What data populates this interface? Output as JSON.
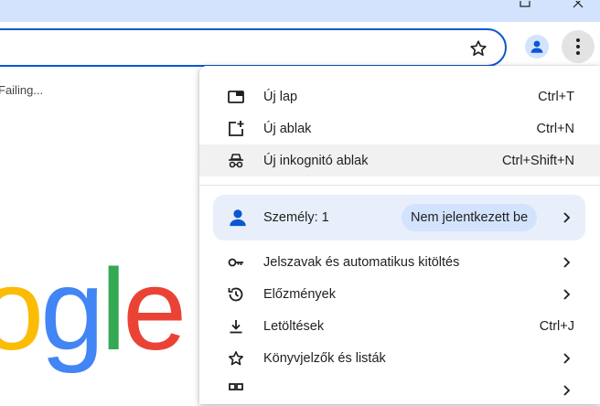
{
  "page": {
    "loading_text": "Failing...",
    "logo_letters": [
      {
        "char": "o",
        "color": "#fbbc05"
      },
      {
        "char": "g",
        "color": "#4285f4"
      },
      {
        "char": "l",
        "color": "#34a853"
      },
      {
        "char": "e",
        "color": "#ea4335"
      }
    ]
  },
  "toolbar": {
    "bookmark_icon": "star-outline-icon",
    "profile_icon": "person-icon",
    "menu_icon": "three-dots-vertical-icon"
  },
  "menu": {
    "top_items": [
      {
        "label": "Új lap",
        "shortcut": "Ctrl+T",
        "icon": "new-tab-icon"
      },
      {
        "label": "Új ablak",
        "shortcut": "Ctrl+N",
        "icon": "new-window-icon"
      },
      {
        "label": "Új inkognitó ablak",
        "shortcut": "Ctrl+Shift+N",
        "icon": "incognito-icon",
        "highlighted": true
      }
    ],
    "profile": {
      "label": "Személy: 1",
      "status": "Nem jelentkezett be"
    },
    "items": [
      {
        "label": "Jelszavak és automatikus kitöltés",
        "icon": "key-icon",
        "submenu": true
      },
      {
        "label": "Előzmények",
        "icon": "history-icon",
        "submenu": true
      },
      {
        "label": "Letöltések",
        "shortcut": "Ctrl+J",
        "icon": "download-icon"
      },
      {
        "label": "Könyvjelzők és listák",
        "icon": "star-icon",
        "submenu": true
      },
      {
        "label": "",
        "icon": "extensions-icon",
        "submenu": true
      }
    ]
  },
  "colors": {
    "titlebar": "#d3e3fd",
    "accent": "#0b57d0",
    "hover": "#f1f1f1",
    "profile_bg": "#e8effb"
  }
}
